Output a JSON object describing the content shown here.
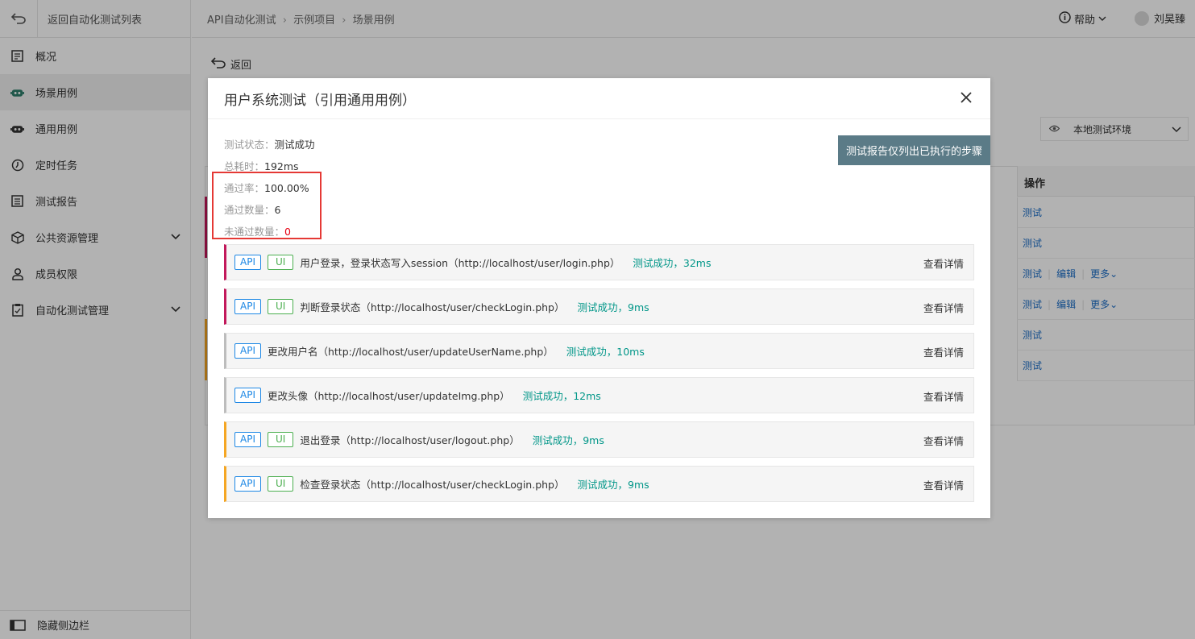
{
  "sidebar": {
    "back_label": "返回自动化测试列表",
    "items": [
      {
        "label": "概况"
      },
      {
        "label": "场景用例"
      },
      {
        "label": "通用用例"
      },
      {
        "label": "定时任务"
      },
      {
        "label": "测试报告"
      },
      {
        "label": "公共资源管理"
      },
      {
        "label": "成员权限"
      },
      {
        "label": "自动化测试管理"
      }
    ],
    "hide_label": "隐藏侧边栏"
  },
  "header": {
    "breadcrumb": [
      "API自动化测试",
      "示例项目",
      "场景用例"
    ],
    "help_label": "帮助",
    "user_name": "刘昊臻"
  },
  "page": {
    "back_label": "返回",
    "env_label": "本地测试环境",
    "ops_header": "操作",
    "ops_rows": [
      [
        "测试"
      ],
      [
        "测试"
      ],
      [
        "测试",
        "编辑",
        "更多"
      ],
      [
        "测试",
        "编辑",
        "更多"
      ],
      [
        "测试"
      ],
      [
        "测试"
      ]
    ]
  },
  "modal": {
    "title": "用户系统测试（引用通用用例）",
    "tip": "测试报告仅列出已执行的步骤",
    "stats": {
      "status_key": "测试状态：",
      "status_val": "测试成功",
      "time_key": "总耗时：",
      "time_val": "192ms",
      "rate_key": "通过率：",
      "rate_val": "100.00%",
      "pass_key": "通过数量：",
      "pass_val": "6",
      "fail_key": "未通过数量：",
      "fail_val": "0"
    },
    "steps": [
      {
        "api": "API",
        "ui": "UI",
        "name": "用户登录，登录状态写入session（http://localhost/user/login.php）",
        "result": "测试成功，32ms",
        "detail": "查看详情",
        "color": "#c2185b"
      },
      {
        "api": "API",
        "ui": "UI",
        "name": "判断登录状态（http://localhost/user/checkLogin.php）",
        "result": "测试成功，9ms",
        "detail": "查看详情",
        "color": "#c2185b"
      },
      {
        "api": "API",
        "ui": "",
        "name": "更改用户名（http://localhost/user/updateUserName.php）",
        "result": "测试成功，10ms",
        "detail": "查看详情",
        "color": "#bdbdbd"
      },
      {
        "api": "API",
        "ui": "",
        "name": "更改头像（http://localhost/user/updateImg.php）",
        "result": "测试成功，12ms",
        "detail": "查看详情",
        "color": "#bdbdbd"
      },
      {
        "api": "API",
        "ui": "UI",
        "name": "退出登录（http://localhost/user/logout.php）",
        "result": "测试成功，9ms",
        "detail": "查看详情",
        "color": "#f5a623"
      },
      {
        "api": "API",
        "ui": "UI",
        "name": "检查登录状态（http://localhost/user/checkLogin.php）",
        "result": "测试成功，9ms",
        "detail": "查看详情",
        "color": "#f5a623"
      }
    ]
  }
}
